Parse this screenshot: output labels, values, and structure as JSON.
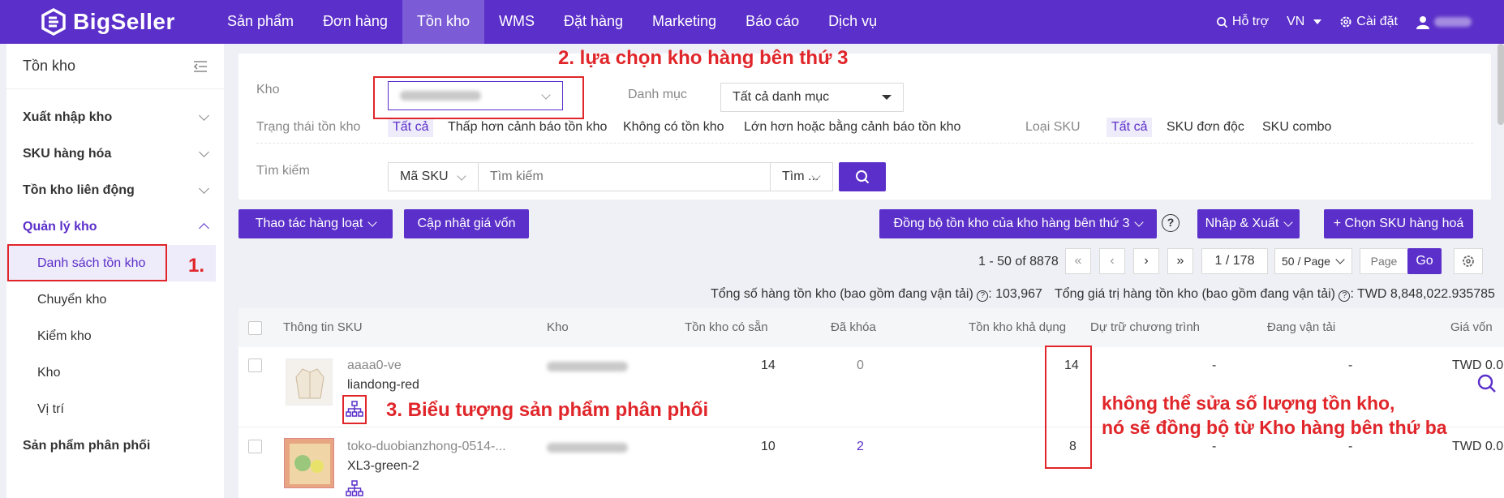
{
  "app": {
    "logo": "BigSeller"
  },
  "nav": [
    "Sản phẩm",
    "Đơn hàng",
    "Tồn kho",
    "WMS",
    "Đặt hàng",
    "Marketing",
    "Báo cáo",
    "Dịch vụ"
  ],
  "top_right": {
    "support": "Hỗ trợ",
    "lang": "VN",
    "settings": "Cài đặt"
  },
  "sidebar": {
    "title": "Tồn kho",
    "groups": [
      "Xuất nhập kho",
      "SKU hàng hóa",
      "Tồn kho liên động",
      "Quản lý kho"
    ],
    "subitems": [
      "Danh sách tồn kho",
      "Chuyển kho",
      "Kiểm kho",
      "Kho",
      "Vị trí"
    ],
    "last": "Sản phẩm phân phối"
  },
  "filters": {
    "warehouse_label": "Kho",
    "category_label": "Danh mục",
    "category_value": "Tất cả danh mục",
    "stock_status_label": "Trạng thái tồn kho",
    "stock_status_options": [
      "Tất cả",
      "Thấp hơn cảnh báo tồn kho",
      "Không có tồn kho",
      "Lớn hơn hoặc bằng cảnh báo tồn kho"
    ],
    "sku_type_label": "Loại SKU",
    "sku_type_options": [
      "Tất cả",
      "SKU đơn độc",
      "SKU combo"
    ],
    "search_label": "Tìm kiếm",
    "search_field": "Mã SKU",
    "search_placeholder": "Tìm kiếm",
    "search_mode": "Tìm ..."
  },
  "toolbar": {
    "bulk": "Thao tác hàng loạt",
    "update_cost": "Cập nhật giá vốn",
    "sync": "Đồng bộ tồn kho của kho hàng bên thứ 3",
    "import_export": "Nhập & Xuất",
    "select_sku": "+ Chọn SKU hàng hoá"
  },
  "pager": {
    "range": "1 - 50 of 8878",
    "page": "1 / 178",
    "per_page": "50 / Page",
    "page_placeholder": "Page",
    "go": "Go"
  },
  "summary": {
    "qty": "Tổng số hàng tồn kho (bao gồm đang vận tải) ",
    "qty_value": ": 103,967",
    "value": "Tổng giá trị hàng tồn kho (bao gồm đang vận tải) ",
    "value_value": ": TWD 8,848,022.935785"
  },
  "table": {
    "headers": [
      "Thông tin SKU",
      "Kho",
      "Tồn kho có sẵn",
      "Đã khóa",
      "Tồn kho khả dụng",
      "Dự trữ chương trình",
      "Đang vận tải",
      "Giá vốn"
    ],
    "rows": [
      {
        "sku": "aaaa0-ve",
        "variant": "liandong-red",
        "available": "14",
        "locked": "0",
        "usable": "14",
        "reserve": "-",
        "transit": "-",
        "cost": "TWD 0.0"
      },
      {
        "sku": "toko-duobianzhong-0514-...",
        "variant": "XL3-green-2",
        "available": "10",
        "locked": "2",
        "usable": "8",
        "reserve": "-",
        "transit": "-",
        "cost": "TWD 0.0"
      }
    ]
  },
  "annotations": {
    "a1": "1.",
    "a2": "2. lựa chọn kho hàng bên thứ 3",
    "a3": "3. Biểu tượng sản phẩm phân phối",
    "a4_line1": "không thể sửa số lượng tồn kho,",
    "a4_line2": "nó sẽ đồng bộ từ Kho hàng bên thứ ba"
  },
  "colors": {
    "brand": "#5b2fc9",
    "annotation": "#e0262a"
  }
}
